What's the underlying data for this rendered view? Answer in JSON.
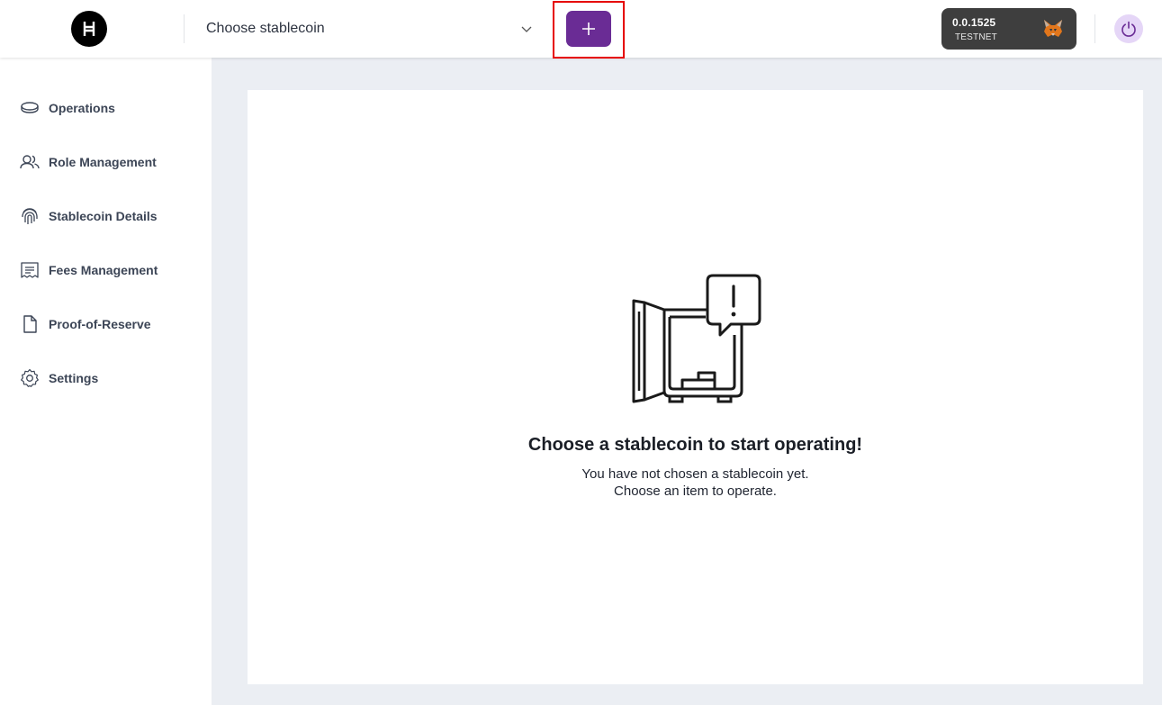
{
  "header": {
    "logo_icon": "hedera-logo-icon",
    "stablecoin_select": {
      "value": "Choose stablecoin",
      "icon": "chevron-down-icon"
    },
    "add_button": {
      "icon": "plus-icon",
      "color": "#6a2c95"
    },
    "wallet": {
      "account": "0.0.1525",
      "network": "TESTNET",
      "icon": "metamask-fox-icon"
    },
    "disconnect_button": {
      "icon": "power-icon"
    }
  },
  "sidebar": {
    "items": [
      {
        "label": "Operations",
        "icon": "coin-icon"
      },
      {
        "label": "Role Management",
        "icon": "users-icon"
      },
      {
        "label": "Stablecoin Details",
        "icon": "fingerprint-icon"
      },
      {
        "label": "Fees Management",
        "icon": "receipt-icon"
      },
      {
        "label": "Proof-of-Reserve",
        "icon": "document-icon"
      },
      {
        "label": "Settings",
        "icon": "gear-icon"
      }
    ]
  },
  "main": {
    "empty_state": {
      "illustration": "open-safe-alert-icon",
      "title": "Choose a stablecoin to start operating!",
      "line1": "You have not chosen a stablecoin yet.",
      "line2": "Choose an item to operate."
    }
  }
}
